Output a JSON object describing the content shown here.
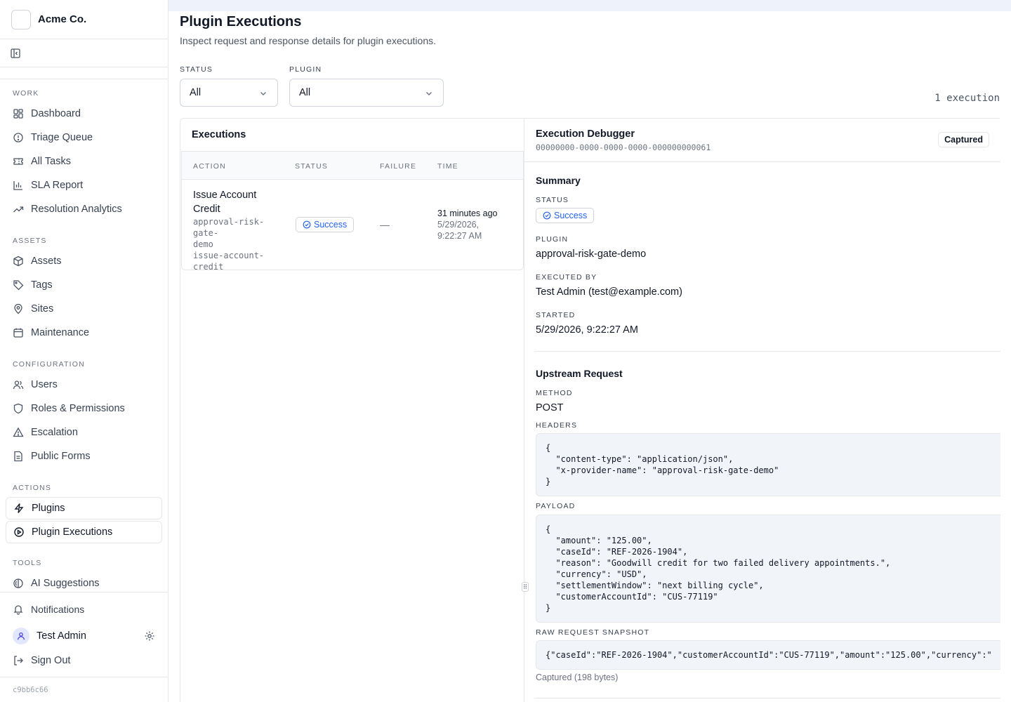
{
  "sidebar": {
    "brand": "Acme Co.",
    "sections": {
      "work": {
        "label": "WORK",
        "items": [
          "Dashboard",
          "Triage Queue",
          "All Tasks",
          "SLA Report",
          "Resolution Analytics"
        ]
      },
      "assets": {
        "label": "ASSETS",
        "items": [
          "Assets",
          "Tags",
          "Sites",
          "Maintenance"
        ]
      },
      "configuration": {
        "label": "CONFIGURATION",
        "items": [
          "Users",
          "Roles & Permissions",
          "Escalation",
          "Public Forms"
        ]
      },
      "actions": {
        "label": "ACTIONS",
        "items": [
          "Plugins",
          "Plugin Executions"
        ]
      },
      "tools": {
        "label": "TOOLS",
        "items": [
          "AI Suggestions"
        ]
      }
    },
    "notifications": "Notifications",
    "user_name": "Test Admin",
    "sign_out": "Sign Out",
    "version": "c9bb6c66"
  },
  "page": {
    "title": "Plugin Executions",
    "subtitle": "Inspect request and response details for plugin executions.",
    "filters": {
      "status_label": "STATUS",
      "status_value": "All",
      "plugin_label": "PLUGIN",
      "plugin_value": "All"
    },
    "count": "1 execution"
  },
  "executions": {
    "title": "Executions",
    "columns": [
      "ACTION",
      "STATUS",
      "FAILURE",
      "TIME"
    ],
    "rows": [
      {
        "action": "Issue Account Credit",
        "action_line1": "Issue Account",
        "action_line2": "Credit",
        "meta1": "approval-risk-gate-",
        "meta2": "demo",
        "meta3": "issue-account-",
        "meta4": "credit",
        "status": "Success",
        "failure": "—",
        "time_relative": "31 minutes ago",
        "time_abs1": "5/29/2026,",
        "time_abs2": "9:22:27 AM"
      }
    ]
  },
  "debugger": {
    "title": "Execution Debugger",
    "id": "00000000-0000-0000-0000-000000000061",
    "captured": "Captured",
    "summary": {
      "heading": "Summary",
      "status_label": "STATUS",
      "status": "Success",
      "plugin_label": "PLUGIN",
      "plugin": "approval-risk-gate-demo",
      "executed_by_label": "EXECUTED BY",
      "executed_by": "Test Admin (test@example.com)",
      "started_label": "STARTED",
      "started": "5/29/2026, 9:22:27 AM"
    },
    "request": {
      "heading": "Upstream Request",
      "method_label": "METHOD",
      "method": "POST",
      "headers_label": "HEADERS",
      "headers": "{\n  \"content-type\": \"application/json\",\n  \"x-provider-name\": \"approval-risk-gate-demo\"\n}",
      "payload_label": "PAYLOAD",
      "payload": "{\n  \"amount\": \"125.00\",\n  \"caseId\": \"REF-2026-1904\",\n  \"reason\": \"Goodwill credit for two failed delivery appointments.\",\n  \"currency\": \"USD\",\n  \"settlementWindow\": \"next billing cycle\",\n  \"customerAccountId\": \"CUS-77119\"\n}",
      "raw_label": "RAW REQUEST SNAPSHOT",
      "raw": "{\"caseId\":\"REF-2026-1904\",\"customerAccountId\":\"CUS-77119\",\"amount\":\"125.00\",\"currency\":\"",
      "raw_note": "Captured (198 bytes)"
    }
  },
  "colors": {
    "accent": "#2563eb",
    "border": "#e5e7eb",
    "code_bg": "#f1f4f9",
    "top_strip": "#eef2fb"
  }
}
